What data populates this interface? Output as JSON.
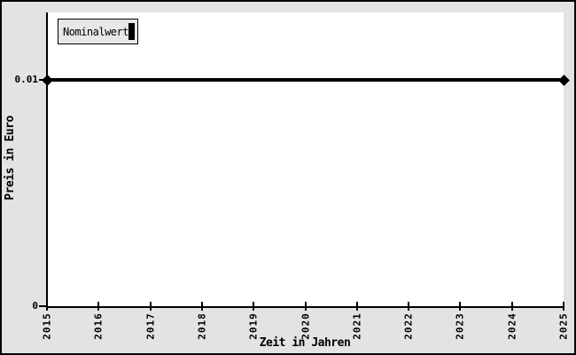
{
  "window": {
    "background": "#e3e3e3",
    "plot_background": "#ffffff",
    "border_color": "#000000",
    "ink_color": "#000000"
  },
  "chart_data": {
    "type": "line",
    "title": "",
    "xlabel": "Zeit in Jahren",
    "ylabel": "Preis in Euro",
    "x_ticks": [
      "2015",
      "2016",
      "2017",
      "2018",
      "2019",
      "2020",
      "2021",
      "2022",
      "2023",
      "2024",
      "2025"
    ],
    "y_ticks": [
      {
        "value": 0.01,
        "label": "0.01"
      },
      {
        "value": 0,
        "label": "0"
      }
    ],
    "xlim": [
      2015,
      2025
    ],
    "ylim": [
      0,
      0.013
    ],
    "grid": false,
    "legend_position": "top-left",
    "legend": {
      "entries": [
        {
          "label": "Nominalwert",
          "marker": "filled-black-rect",
          "color": "#000000"
        }
      ]
    },
    "series": [
      {
        "name": "Nominalwert",
        "x": [
          2015,
          2025
        ],
        "values": [
          0.01,
          0.01
        ],
        "color": "#000000",
        "marker": "diamond",
        "line_width": 4
      }
    ]
  }
}
